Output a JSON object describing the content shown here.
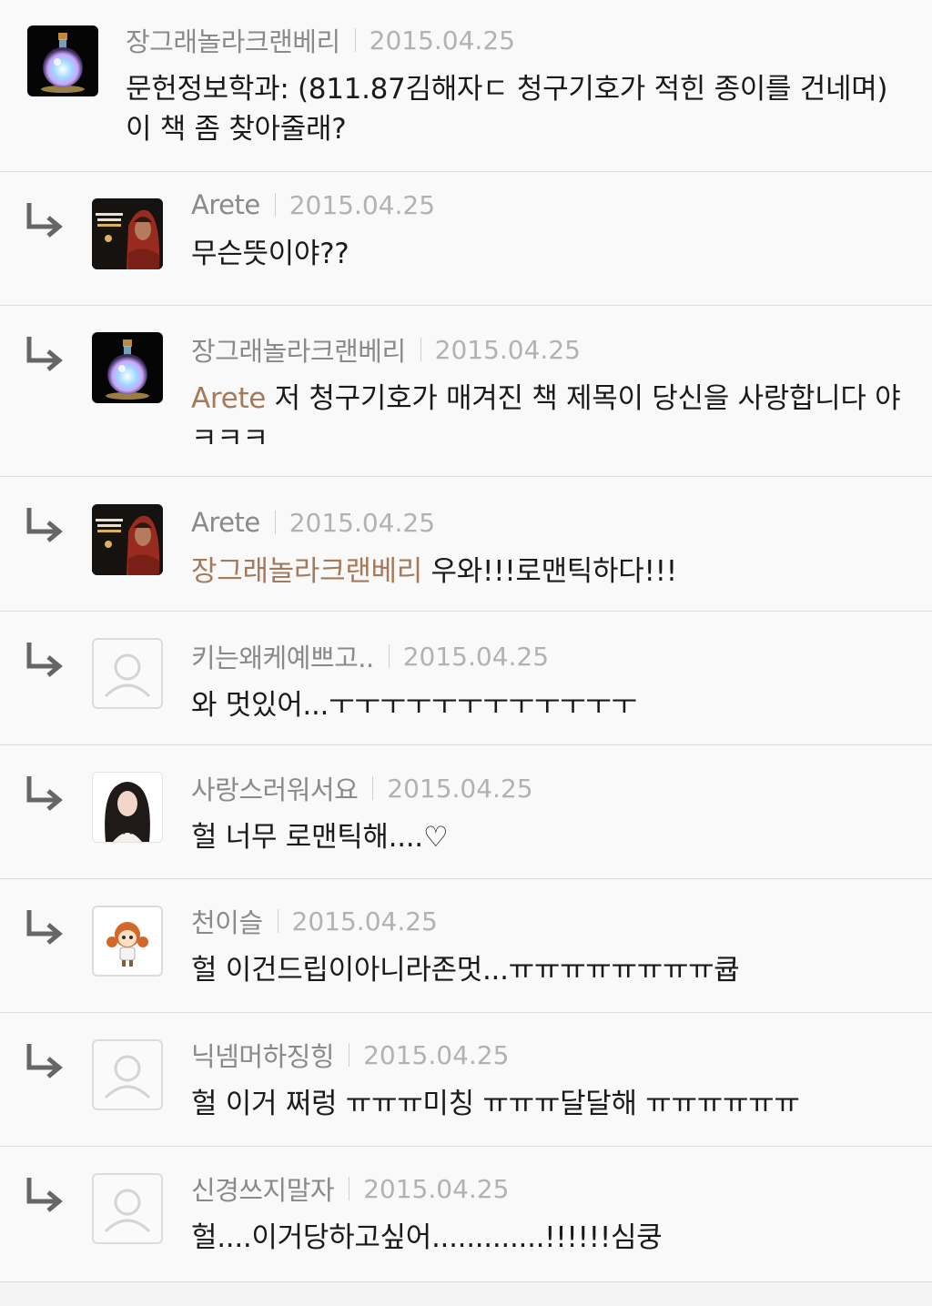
{
  "comments": [
    {
      "author": "장그래놀라크랜베리",
      "date": "2015.04.25",
      "mention": "",
      "text": "문헌정보학과: (811.87김해자ㄷ 청구기호가 적힌 종이를 건네며) 이 책 좀 찾아줄래?",
      "avatar": "potion-bottle"
    },
    {
      "author": "Arete",
      "date": "2015.04.25",
      "mention": "",
      "text": "무슨뜻이야??",
      "avatar": "portrait-red-scarf"
    },
    {
      "author": "장그래놀라크랜베리",
      "date": "2015.04.25",
      "mention": "Arete",
      "text": " 저 청구기호가 매겨진 책 제목이 당신을 사랑합니다 야ㅋㅋㅋ",
      "avatar": "potion-bottle"
    },
    {
      "author": "Arete",
      "date": "2015.04.25",
      "mention": "장그래놀라크랜베리",
      "text": " 우와!!!로맨틱하다!!!",
      "avatar": "portrait-red-scarf"
    },
    {
      "author": "키는왜케예쁘고..",
      "date": "2015.04.25",
      "mention": "",
      "text": "와 멋있어...ㅜㅜㅜㅜㅜㅜㅜㅜㅜㅜㅜㅜ",
      "avatar": "default-user"
    },
    {
      "author": "사랑스러워서요",
      "date": "2015.04.25",
      "mention": "",
      "text": "헐 너무 로맨틱해....♡",
      "avatar": "portrait-dark-hair"
    },
    {
      "author": "천이슬",
      "date": "2015.04.25",
      "mention": "",
      "text": "헐 이건드립이아니라존멋...ㅠㅠㅠㅠㅠㅠㅠㅠ큡",
      "avatar": "pixel-character"
    },
    {
      "author": "닉넴머하징힝",
      "date": "2015.04.25",
      "mention": "",
      "text": "헐 이거 쩌렁 ㅠㅠㅠ미칭 ㅠㅠㅠ달달해 ㅠㅠㅠㅠㅠㅠ",
      "avatar": "default-user"
    },
    {
      "author": "신경쓰지말자",
      "date": "2015.04.25",
      "mention": "",
      "text": "헐....이거당하고싶어.............!!!!!!심쿵",
      "avatar": "default-user"
    }
  ]
}
